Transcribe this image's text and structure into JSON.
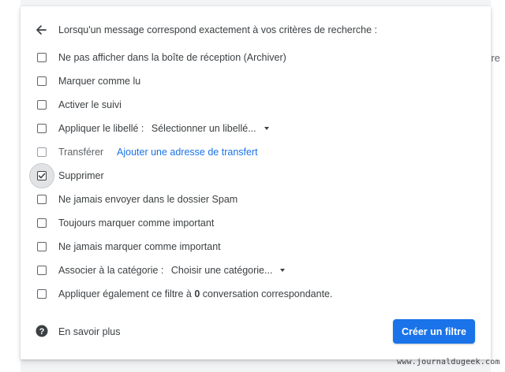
{
  "header": {
    "text": "Lorsqu'un message correspond exactement à vos critères de recherche :"
  },
  "background": {
    "right_text": "rre"
  },
  "options": [
    {
      "label": "Ne pas afficher dans la boîte de réception (Archiver)",
      "checked": false
    },
    {
      "label": "Marquer comme lu",
      "checked": false
    },
    {
      "label": "Activer le suivi",
      "checked": false
    },
    {
      "label": "Appliquer le libellé :",
      "select": "Sélectionner un libellé...",
      "checked": false
    },
    {
      "label": "Transférer",
      "link": "Ajouter une adresse de transfert",
      "checked": false,
      "disabled": true
    },
    {
      "label": "Supprimer",
      "checked": true
    },
    {
      "label": "Ne jamais envoyer dans le dossier Spam",
      "checked": false
    },
    {
      "label": "Toujours marquer comme important",
      "checked": false
    },
    {
      "label": "Ne jamais marquer comme important",
      "checked": false
    },
    {
      "label": "Associer à la catégorie :",
      "select": "Choisir une catégorie...",
      "checked": false
    },
    {
      "label_prefix": "Appliquer également ce filtre à",
      "count": "0",
      "label_suffix": "conversation correspondante.",
      "checked": false
    }
  ],
  "footer": {
    "help_label": "En savoir plus",
    "create_button": "Créer un filtre"
  },
  "watermark": "www.journaldugeek.com",
  "colors": {
    "accent": "#1a73e8",
    "text": "#3c4043"
  }
}
